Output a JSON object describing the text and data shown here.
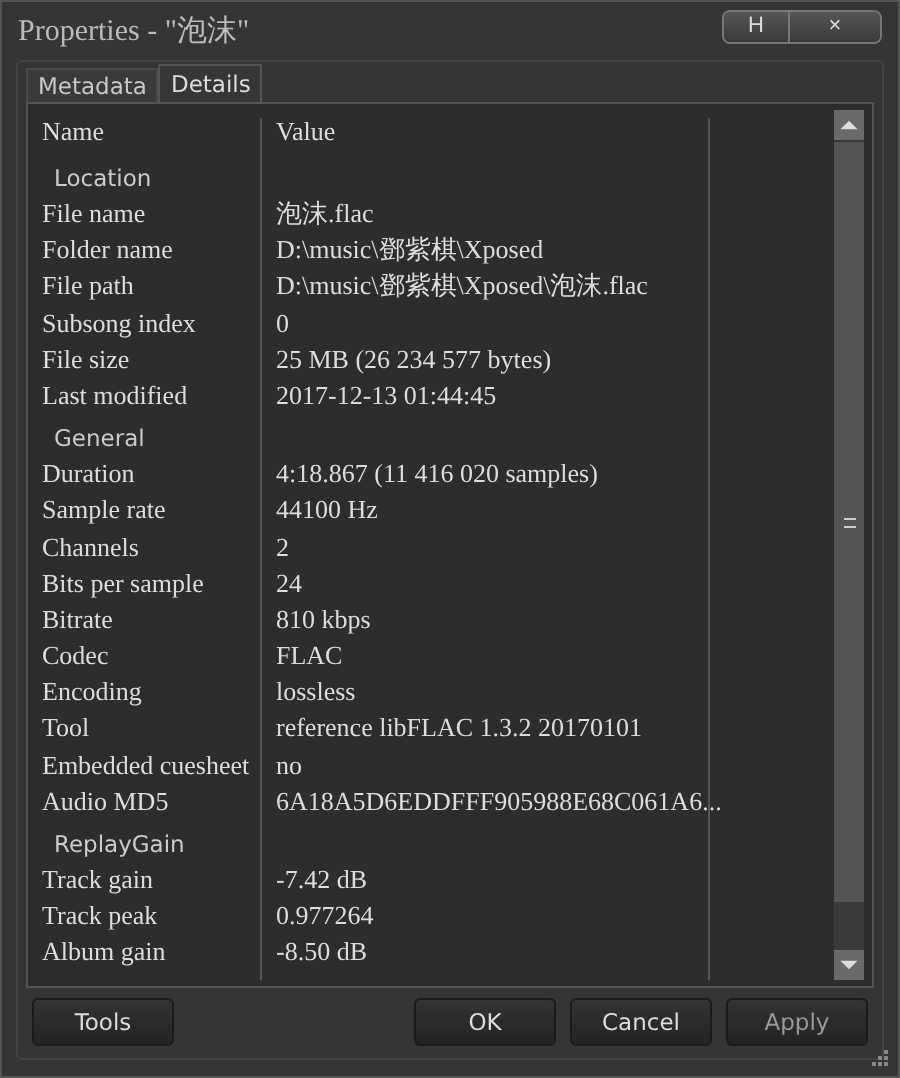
{
  "window": {
    "title": "Properties - \"泡沫\"",
    "controls": [
      "H",
      "×"
    ]
  },
  "tabs": [
    {
      "label": "Metadata",
      "selected": false
    },
    {
      "label": "Details",
      "selected": true
    }
  ],
  "list": {
    "columns": [
      "Name",
      "Value"
    ],
    "sections": [
      {
        "title": "Location",
        "rows": [
          {
            "name": "File name",
            "value": "泡沫.flac"
          },
          {
            "name": "Folder name",
            "value": "D:\\music\\鄧紫棋\\Xposed"
          },
          {
            "name": "File path",
            "value": "D:\\music\\鄧紫棋\\Xposed\\泡沫.flac"
          },
          {
            "name": "Subsong index",
            "value": "0"
          },
          {
            "name": "File size",
            "value": "25 MB (26 234 577 bytes)"
          },
          {
            "name": "Last modified",
            "value": "2017-12-13 01:44:45"
          }
        ]
      },
      {
        "title": "General",
        "rows": [
          {
            "name": "Duration",
            "value": "4:18.867 (11 416 020 samples)"
          },
          {
            "name": "Sample rate",
            "value": "44100 Hz"
          },
          {
            "name": "Channels",
            "value": "2"
          },
          {
            "name": "Bits per sample",
            "value": "24"
          },
          {
            "name": "Bitrate",
            "value": "810 kbps"
          },
          {
            "name": "Codec",
            "value": "FLAC"
          },
          {
            "name": "Encoding",
            "value": "lossless"
          },
          {
            "name": "Tool",
            "value": "reference libFLAC 1.3.2 20170101"
          },
          {
            "name": "Embedded cuesheet",
            "value": "no"
          },
          {
            "name": "Audio MD5",
            "value": "6A18A5D6EDDFFF905988E68C061A6..."
          }
        ]
      },
      {
        "title": "ReplayGain",
        "rows": [
          {
            "name": "Track gain",
            "value": "-7.42 dB"
          },
          {
            "name": "Track peak",
            "value": "0.977264"
          },
          {
            "name": "Album gain",
            "value": "-8.50 dB"
          }
        ]
      }
    ]
  },
  "buttons": [
    {
      "label": "Tools",
      "disabled": false
    },
    {
      "label": "OK",
      "disabled": false
    },
    {
      "label": "Cancel",
      "disabled": false
    },
    {
      "label": "Apply",
      "disabled": true
    }
  ]
}
